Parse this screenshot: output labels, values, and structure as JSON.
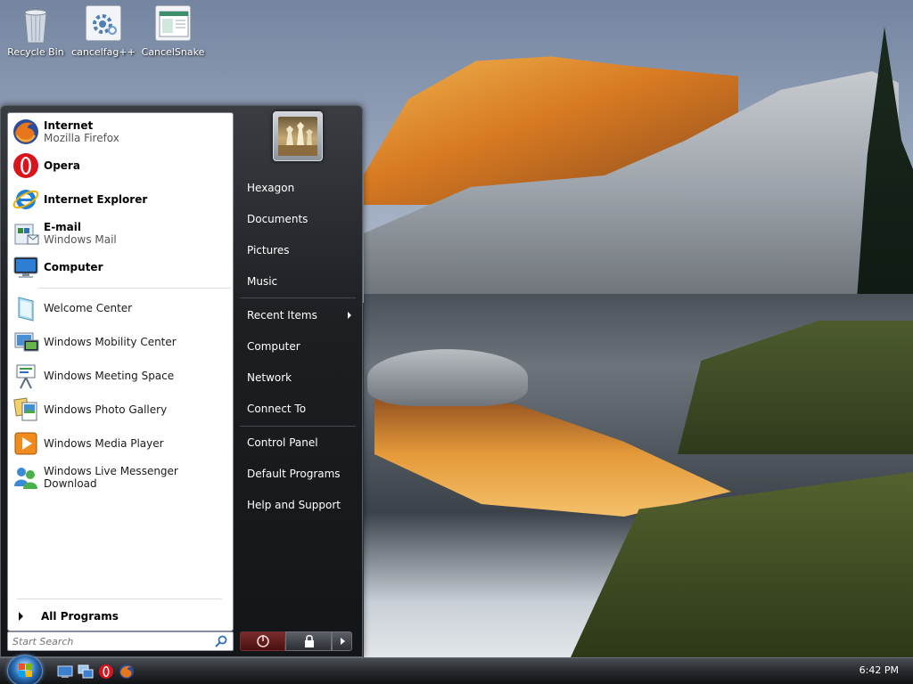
{
  "desktop": {
    "icons": [
      {
        "label": "Recycle Bin",
        "icon": "recycle-bin-icon"
      },
      {
        "label": "cancelfag++",
        "icon": "settings-app-icon"
      },
      {
        "label": "CancelSnake",
        "icon": "app-window-icon"
      }
    ]
  },
  "start_menu": {
    "pinned": [
      {
        "title": "Internet",
        "subtitle": "Mozilla Firefox",
        "icon": "firefox-icon"
      },
      {
        "title": "Opera",
        "icon": "opera-icon"
      },
      {
        "title": "Internet Explorer",
        "icon": "internet-explorer-icon"
      },
      {
        "title": "E-mail",
        "subtitle": "Windows Mail",
        "icon": "windows-mail-icon"
      },
      {
        "title": "Computer",
        "icon": "computer-icon"
      }
    ],
    "recent": [
      {
        "label": "Welcome Center",
        "icon": "welcome-center-icon"
      },
      {
        "label": "Windows Mobility Center",
        "icon": "mobility-center-icon"
      },
      {
        "label": "Windows Meeting Space",
        "icon": "meeting-space-icon"
      },
      {
        "label": "Windows Photo Gallery",
        "icon": "photo-gallery-icon"
      },
      {
        "label": "Windows Media Player",
        "icon": "media-player-icon"
      },
      {
        "label": "Windows Live Messenger Download",
        "icon": "messenger-icon"
      }
    ],
    "all_programs": "All Programs",
    "search_placeholder": "Start Search",
    "right_items": [
      {
        "label": "Hexagon"
      },
      {
        "label": "Documents"
      },
      {
        "label": "Pictures"
      },
      {
        "label": "Music"
      },
      {
        "label": "Recent Items"
      },
      {
        "label": "Computer"
      },
      {
        "label": "Network"
      },
      {
        "label": "Connect To"
      },
      {
        "label": "Control Panel"
      },
      {
        "label": "Default Programs"
      },
      {
        "label": "Help and Support"
      }
    ],
    "user_picture": "chess-pieces-picture"
  },
  "taskbar": {
    "clock": "6:42 PM",
    "quick_launch": [
      "show-desktop-icon",
      "switch-windows-icon",
      "opera-icon",
      "firefox-icon"
    ]
  },
  "colors": {
    "start_menu_dark": "#1c1e22",
    "power_red": "#7a2c2c",
    "taskbar": "#2a2d31"
  }
}
